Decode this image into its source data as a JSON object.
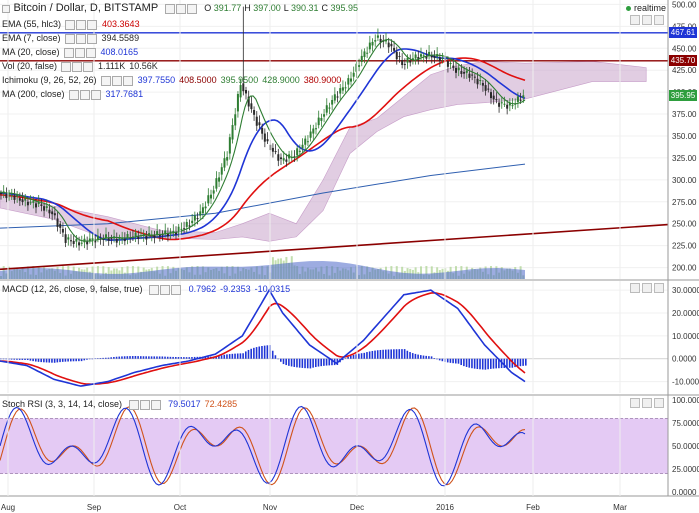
{
  "header": {
    "symbol": "Bitcoin / Dollar, D, BITSTAMP",
    "ohlc": [
      {
        "k": "O",
        "v": "391.77"
      },
      {
        "k": "H",
        "v": "397.00"
      },
      {
        "k": "L",
        "v": "390.31"
      },
      {
        "k": "C",
        "v": "395.95"
      }
    ],
    "realtime": "realtime"
  },
  "indicators": [
    {
      "label": "EMA (55, hlc3)",
      "values": [
        "403.3643"
      ],
      "colors": [
        "#cc0000"
      ]
    },
    {
      "label": "EMA (7, close)",
      "values": [
        "394.5589"
      ],
      "colors": [
        "#2a2a2a"
      ]
    },
    {
      "label": "MA (20, close)",
      "values": [
        "408.0165"
      ],
      "colors": [
        "#1f35d6"
      ]
    },
    {
      "label": "Vol (20, false)",
      "values": [
        "1.111K",
        "10.56K"
      ],
      "colors": [
        "#2a2a2a",
        "#2a2a2a"
      ]
    },
    {
      "label": "Ichimoku (9, 26, 52, 26)",
      "values": [
        "397.7550",
        "408.5000",
        "395.9500",
        "428.9000",
        "380.9000"
      ],
      "colors": [
        "#1f35d6",
        "#8b0000",
        "#2e7d32",
        "#2e7d32",
        "#b00000"
      ]
    },
    {
      "label": "MA (200, close)",
      "values": [
        "317.7681"
      ],
      "colors": [
        "#1f35d6"
      ]
    }
  ],
  "macd": {
    "label": "MACD (12, 26, close, 9, false, true)",
    "values": [
      "0.7962",
      "-9.2353",
      "-10.0315"
    ],
    "colors": [
      "#1f35d6",
      "#1f35d6",
      "#1f35d6"
    ]
  },
  "rsi": {
    "label": "Stoch RSI (3, 3, 14, 14, close)",
    "values": [
      "79.5017",
      "72.4285"
    ],
    "colors": [
      "#1f35d6",
      "#d0531b"
    ]
  },
  "price_badges": [
    {
      "value": "467.61",
      "color": "#1f35d6"
    },
    {
      "value": "435.70",
      "color": "#8b0000"
    },
    {
      "value": "395.95",
      "color": "#2e9e3e"
    }
  ],
  "colors": {
    "up": "#2e7d32",
    "down": "#2a2a2a",
    "ema55": "#e01010",
    "ma20": "#1f35d6",
    "ma200": "#2f5fb0",
    "cloud": "#c9a6cc",
    "trend": "#8b0000",
    "macd": "#1f35d6",
    "signal": "#e01010",
    "hist": "#1f35d6",
    "rsi_band": "#d9b3f0",
    "volume": "#a9d18e"
  },
  "chart_data": {
    "type": "line",
    "x_ticks": [
      "Aug",
      "Sep",
      "Oct",
      "Nov",
      "Dec",
      "2016",
      "Feb",
      "Mar"
    ],
    "price": {
      "y_ticks": [
        "500.00",
        "475.00",
        "450.00",
        "425.00",
        "400.00",
        "375.00",
        "350.00",
        "325.00",
        "300.00",
        "275.00",
        "250.00",
        "225.00",
        "200.00"
      ],
      "ylim": [
        187,
        505
      ],
      "horizontal_lines": [
        467.61,
        435.7
      ],
      "trendline": {
        "from": [
          "Aug",
          198
        ],
        "to": [
          "Mar+",
          250
        ]
      },
      "close_path": [
        [
          0,
          285
        ],
        [
          5,
          282
        ],
        [
          10,
          275
        ],
        [
          15,
          272
        ],
        [
          20,
          262
        ],
        [
          25,
          232
        ],
        [
          30,
          228
        ],
        [
          35,
          232
        ],
        [
          40,
          234
        ],
        [
          45,
          232
        ],
        [
          50,
          236
        ],
        [
          55,
          236
        ],
        [
          60,
          238
        ],
        [
          65,
          240
        ],
        [
          70,
          248
        ],
        [
          75,
          262
        ],
        [
          80,
          290
        ],
        [
          85,
          330
        ],
        [
          90,
          410
        ],
        [
          95,
          372
        ],
        [
          100,
          340
        ],
        [
          105,
          322
        ],
        [
          110,
          328
        ],
        [
          115,
          348
        ],
        [
          120,
          372
        ],
        [
          125,
          395
        ],
        [
          130,
          412
        ],
        [
          135,
          440
        ],
        [
          140,
          462
        ],
        [
          145,
          455
        ],
        [
          150,
          432
        ],
        [
          155,
          440
        ],
        [
          160,
          442
        ],
        [
          165,
          438
        ],
        [
          170,
          425
        ],
        [
          175,
          420
        ],
        [
          180,
          408
        ],
        [
          185,
          388
        ],
        [
          190,
          384
        ],
        [
          195,
          396
        ]
      ],
      "ma200_path": [
        [
          0,
          245
        ],
        [
          40,
          250
        ],
        [
          80,
          262
        ],
        [
          120,
          285
        ],
        [
          160,
          305
        ],
        [
          195,
          318
        ]
      ]
    },
    "macd": {
      "y_ticks": [
        "30.0000",
        "20.0000",
        "10.0000",
        "0.0000",
        "-10.0000"
      ],
      "ylim": [
        -15,
        34
      ]
    },
    "stoch_rsi": {
      "y_ticks": [
        "100.0000",
        "75.0000",
        "50.0000",
        "25.0000",
        "0.0000"
      ],
      "ylim": [
        0,
        100
      ],
      "band": [
        20,
        80
      ]
    }
  }
}
